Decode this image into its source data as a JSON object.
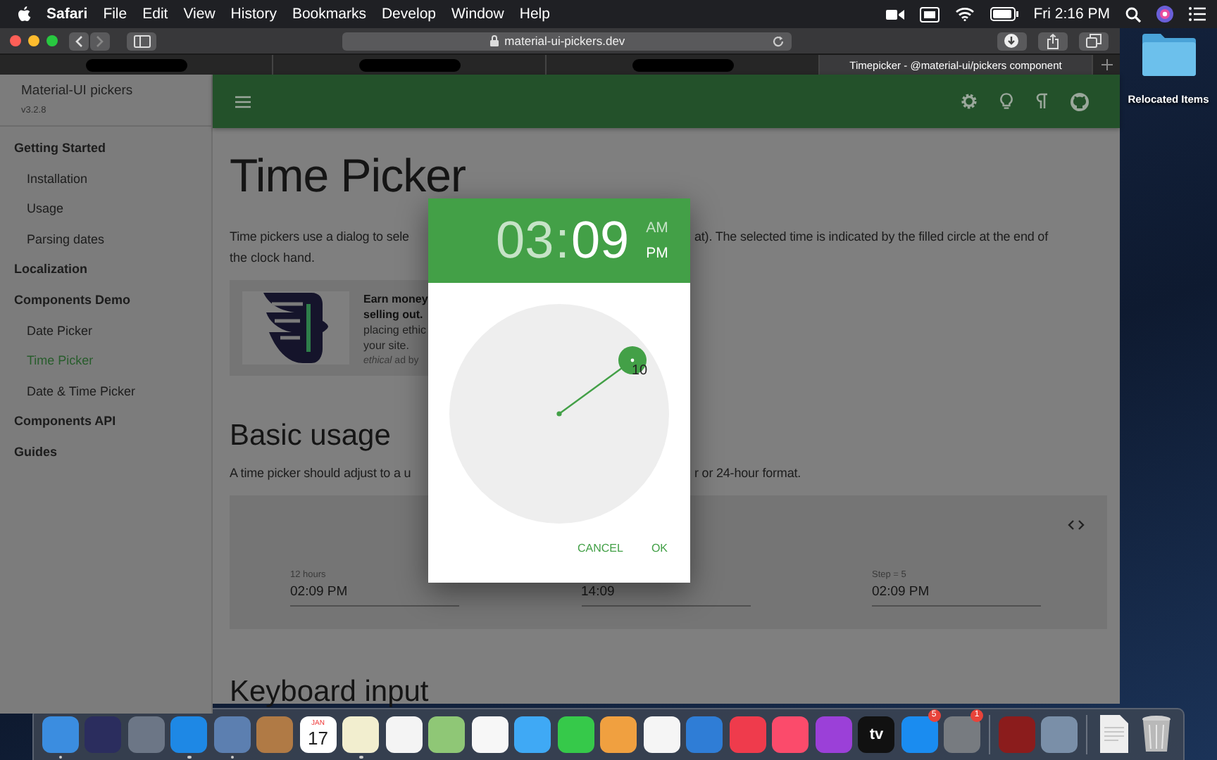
{
  "menu_bar": {
    "app": "Safari",
    "menus": [
      "File",
      "Edit",
      "View",
      "History",
      "Bookmarks",
      "Develop",
      "Window",
      "Help"
    ],
    "clock": "Fri 2:16 PM"
  },
  "browser": {
    "address": "material-ui-pickers.dev",
    "tabs": [
      {
        "redacted": true,
        "selected": false
      },
      {
        "redacted": true,
        "selected": false
      },
      {
        "redacted": true,
        "selected": false
      },
      {
        "redacted": false,
        "title": "Timepicker - @material-ui/pickers component",
        "selected": true
      }
    ]
  },
  "sidebar": {
    "title": "Material-UI pickers",
    "version": "v3.2.8",
    "items": [
      {
        "label": "Getting Started",
        "selected": false,
        "children": [
          {
            "label": "Installation",
            "selected": false
          },
          {
            "label": "Usage",
            "selected": false
          },
          {
            "label": "Parsing dates",
            "selected": false
          }
        ]
      },
      {
        "label": "Localization",
        "selected": false
      },
      {
        "label": "Components Demo",
        "selected": false,
        "children": [
          {
            "label": "Date Picker",
            "selected": false
          },
          {
            "label": "Time Picker",
            "selected": true
          },
          {
            "label": "Date & Time Picker",
            "selected": false
          }
        ]
      },
      {
        "label": "Components API",
        "selected": false
      },
      {
        "label": "Guides",
        "selected": false
      }
    ]
  },
  "article": {
    "title": "Time Picker",
    "intro": {
      "line_1_left": "Time pickers use a dialog to sele",
      "line_1_right": "at). The selected time is indicated by the filled circle at the end of",
      "line_2": "the clock hand."
    },
    "ad": {
      "headline": [
        "Earn money",
        "selling out."
      ],
      "body": [
        "placing ethic",
        "your site."
      ],
      "credit": "*ethical* ad by"
    },
    "section_title": "Basic usage",
    "section_text": {
      "left": "A time picker should adjust to a u",
      "right": "r or 24-hour format."
    },
    "demo_fields": [
      {
        "label": "12 hours",
        "value": "02:09 PM"
      },
      {
        "value": "14:09"
      },
      {
        "label": "Step = 5",
        "value": "02:09 PM"
      }
    ],
    "next_section_title": "Keyboard input"
  },
  "dialog": {
    "hours": {
      "text": "03",
      "selected": false
    },
    "separator": ":",
    "minutes": {
      "text": "09",
      "selected": true
    },
    "meridiem": [
      {
        "text": "AM",
        "selected": false
      },
      {
        "text": "PM",
        "selected": true
      }
    ],
    "clock_label": "10",
    "actions": [
      "CANCEL",
      "OK"
    ]
  },
  "desktop_items": [
    {
      "label": "Relocated Items"
    }
  ],
  "dock": [
    {
      "kind": "app",
      "color": "#3b8de0",
      "running": true
    },
    {
      "kind": "app",
      "color": "#2b2d5e",
      "running": false
    },
    {
      "kind": "app",
      "color": "#6c7686",
      "running": false
    },
    {
      "kind": "app",
      "color": "#1e88e5",
      "running": true
    },
    {
      "kind": "app",
      "color": "#5c7fb0",
      "running": true
    },
    {
      "kind": "app",
      "color": "#b07a45",
      "running": false
    },
    {
      "kind": "calendar",
      "month": "JAN",
      "day": "17",
      "running": false
    },
    {
      "kind": "app",
      "color": "#f2eecf",
      "running": true
    },
    {
      "kind": "app",
      "color": "#f4f4f4",
      "running": false
    },
    {
      "kind": "app",
      "color": "#8fc776",
      "running": false
    },
    {
      "kind": "app",
      "color": "#f7f7f7",
      "running": false
    },
    {
      "kind": "app",
      "color": "#3fa9f5",
      "running": false
    },
    {
      "kind": "app",
      "color": "#36c94a",
      "running": false
    },
    {
      "kind": "app",
      "color": "#f0a040",
      "running": false
    },
    {
      "kind": "app",
      "color": "#f5f5f5",
      "running": false
    },
    {
      "kind": "app",
      "color": "#2f7dd6",
      "running": false
    },
    {
      "kind": "app",
      "color": "#ef3b4c",
      "running": false
    },
    {
      "kind": "app",
      "color": "#fb4b6b",
      "running": false
    },
    {
      "kind": "app",
      "color": "#9b40d8",
      "running": false
    },
    {
      "kind": "tv",
      "label": "tv",
      "running": false
    },
    {
      "kind": "app",
      "color": "#1a8cf0",
      "running": false,
      "badge": "5"
    },
    {
      "kind": "app",
      "color": "#777b80",
      "running": false,
      "badge": "1"
    },
    {
      "kind": "separator"
    },
    {
      "kind": "app",
      "color": "#8b1c1c",
      "running": false
    },
    {
      "kind": "app",
      "color": "#7a8fa8",
      "running": false
    },
    {
      "kind": "separator"
    },
    {
      "kind": "document",
      "running": false
    },
    {
      "kind": "trash",
      "running": false
    }
  ]
}
